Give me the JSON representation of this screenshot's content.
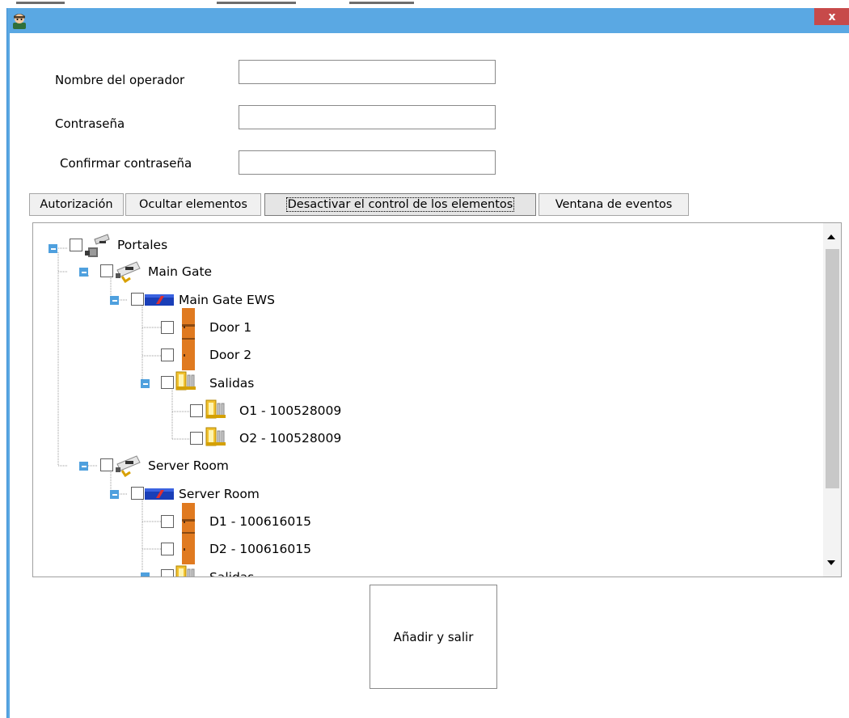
{
  "window": {
    "close_label": "x",
    "accent_color": "#5aa8e3",
    "close_color": "#c74a4a",
    "app_icon": "operator-avatar-icon"
  },
  "form": {
    "operator_name_label": "Nombre del operador",
    "operator_name_value": "",
    "password_label": "Contraseña",
    "password_value": "",
    "confirm_password_label": "Confirmar contraseña",
    "confirm_password_value": ""
  },
  "tabs": [
    {
      "label": "Autorización"
    },
    {
      "label": "Ocultar elementos"
    },
    {
      "label": "Desactivar el control de los elementos",
      "active": true
    },
    {
      "label": "Ventana de eventos"
    }
  ],
  "tree": {
    "nodes": [
      {
        "label": "Portales",
        "icon": "portals-icon",
        "checked": false,
        "expanded": true
      },
      {
        "label": "Main Gate",
        "icon": "gate-camera-icon",
        "checked": false,
        "expanded": true
      },
      {
        "label": "Main Gate EWS",
        "icon": "ews-controller-icon",
        "checked": false,
        "expanded": true
      },
      {
        "label": "Door 1",
        "icon": "door-icon",
        "checked": false
      },
      {
        "label": "Door 2",
        "icon": "door-icon",
        "checked": false
      },
      {
        "label": "Salidas",
        "icon": "outputs-icon",
        "checked": false,
        "expanded": true
      },
      {
        "label": "O1 - 100528009",
        "icon": "output-icon",
        "checked": false
      },
      {
        "label": "O2 - 100528009",
        "icon": "output-icon",
        "checked": false
      },
      {
        "label": "Server Room",
        "icon": "gate-camera-icon",
        "checked": false,
        "expanded": true
      },
      {
        "label": "Server Room",
        "icon": "ews-controller-icon",
        "checked": false,
        "expanded": true
      },
      {
        "label": "D1 - 100616015",
        "icon": "door-icon",
        "checked": false
      },
      {
        "label": "D2 - 100616015",
        "icon": "door-icon",
        "checked": false
      },
      {
        "label": "Salidas",
        "icon": "outputs-icon",
        "checked": false,
        "expanded": true
      }
    ]
  },
  "actions": {
    "add_and_exit_label": "Añadir y salir"
  }
}
